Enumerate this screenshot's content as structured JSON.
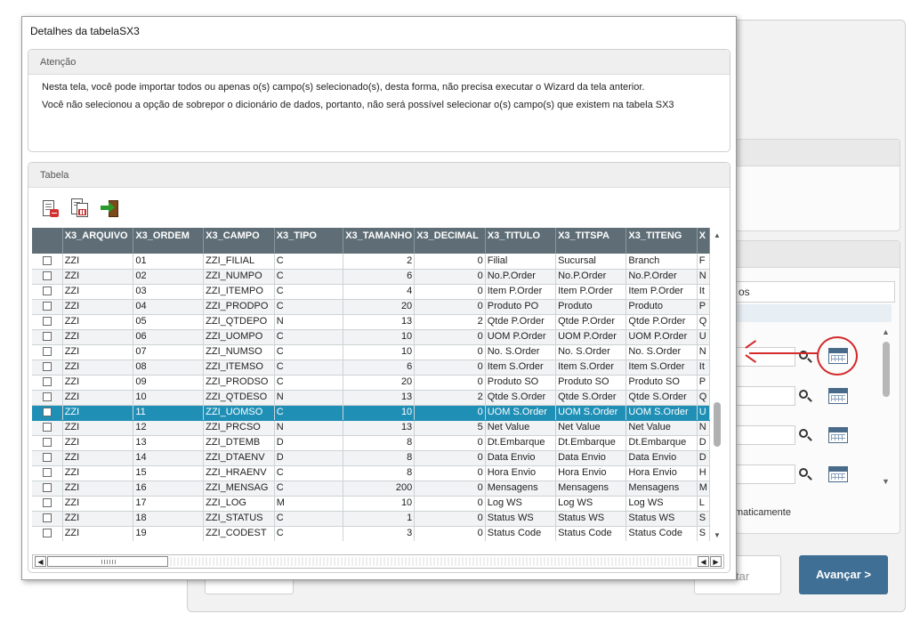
{
  "background": {
    "tab_label": "os",
    "auto_text": "maticamente",
    "btn_mid_label": "tar",
    "btn_next_label": "Avançar >",
    "colors": {
      "next_button": "#3f6f94",
      "annotation": "#d42a2a"
    }
  },
  "dialog": {
    "title": "Detalhes da tabelaSX3",
    "attention": {
      "header": "Atenção",
      "line1": "Nesta tela, você pode importar todos ou apenas o(s) campo(s) selecionado(s), desta forma, não precisa executar o Wizard da tela anterior.",
      "line2": "Você não selecionou a opção de sobrepor o dicionário de dados, portanto, não será possível selecionar  o(s) campo(s) que existem na tabela SX3"
    },
    "table_group": {
      "header": "Tabela",
      "toolbar_icons": [
        "remove-document-icon",
        "export-document-icon",
        "exit-door-icon"
      ]
    },
    "grid": {
      "columns": [
        "",
        "X3_ARQUIVO",
        "X3_ORDEM",
        "X3_CAMPO",
        "X3_TIPO",
        "X3_TAMANHO",
        "X3_DECIMAL",
        "X3_TITULO",
        "X3_TITSPA",
        "X3_TITENG",
        "X"
      ],
      "selected_row": 10,
      "selection_color": "#1f8fb5",
      "rows": [
        [
          "ZZI",
          "01",
          "ZZI_FILIAL",
          "C",
          "2",
          "0",
          "Filial",
          "Sucursal",
          "Branch",
          "F"
        ],
        [
          "ZZI",
          "02",
          "ZZI_NUMPO",
          "C",
          "6",
          "0",
          "No.P.Order",
          "No.P.Order",
          "No.P.Order",
          "N"
        ],
        [
          "ZZI",
          "03",
          "ZZI_ITEMPO",
          "C",
          "4",
          "0",
          "Item P.Order",
          "Item P.Order",
          "Item P.Order",
          "It"
        ],
        [
          "ZZI",
          "04",
          "ZZI_PRODPO",
          "C",
          "20",
          "0",
          "Produto PO",
          "Produto",
          "Produto",
          "P"
        ],
        [
          "ZZI",
          "05",
          "ZZI_QTDEPO",
          "N",
          "13",
          "2",
          "Qtde P.Order",
          "Qtde P.Order",
          "Qtde P.Order",
          "Q"
        ],
        [
          "ZZI",
          "06",
          "ZZI_UOMPO",
          "C",
          "10",
          "0",
          "UOM P.Order",
          "UOM P.Order",
          "UOM P.Order",
          "U"
        ],
        [
          "ZZI",
          "07",
          "ZZI_NUMSO",
          "C",
          "10",
          "0",
          "No. S.Order",
          "No. S.Order",
          "No. S.Order",
          "N"
        ],
        [
          "ZZI",
          "08",
          "ZZI_ITEMSO",
          "C",
          "6",
          "0",
          "Item S.Order",
          "Item S.Order",
          "Item S.Order",
          "It"
        ],
        [
          "ZZI",
          "09",
          "ZZI_PRODSO",
          "C",
          "20",
          "0",
          "Produto SO",
          "Produto SO",
          "Produto SO",
          "P"
        ],
        [
          "ZZI",
          "10",
          "ZZI_QTDESO",
          "N",
          "13",
          "2",
          "Qtde S.Order",
          "Qtde S.Order",
          "Qtde S.Order",
          "Q"
        ],
        [
          "ZZI",
          "11",
          "ZZI_UOMSO",
          "C",
          "10",
          "0",
          "UOM S.Order",
          "UOM S.Order",
          "UOM S.Order",
          "U"
        ],
        [
          "ZZI",
          "12",
          "ZZI_PRCSO",
          "N",
          "13",
          "5",
          "Net Value",
          "Net Value",
          "Net Value",
          "N"
        ],
        [
          "ZZI",
          "13",
          "ZZI_DTEMB",
          "D",
          "8",
          "0",
          "Dt.Embarque",
          "Dt.Embarque",
          "Dt.Embarque",
          "D"
        ],
        [
          "ZZI",
          "14",
          "ZZI_DTAENV",
          "D",
          "8",
          "0",
          "Data Envio",
          "Data Envio",
          "Data Envio",
          "D"
        ],
        [
          "ZZI",
          "15",
          "ZZI_HRAENV",
          "C",
          "8",
          "0",
          "Hora Envio",
          "Hora Envio",
          "Hora Envio",
          "H"
        ],
        [
          "ZZI",
          "16",
          "ZZI_MENSAG",
          "C",
          "200",
          "0",
          "Mensagens",
          "Mensagens",
          "Mensagens",
          "M"
        ],
        [
          "ZZI",
          "17",
          "ZZI_LOG",
          "M",
          "10",
          "0",
          "Log WS",
          "Log WS",
          "Log WS",
          "L"
        ],
        [
          "ZZI",
          "18",
          "ZZI_STATUS",
          "C",
          "1",
          "0",
          "Status WS",
          "Status WS",
          "Status WS",
          "S"
        ],
        [
          "ZZI",
          "19",
          "ZZI_CODEST",
          "C",
          "3",
          "0",
          "Status Code",
          "Status Code",
          "Status Code",
          "S"
        ]
      ]
    }
  }
}
